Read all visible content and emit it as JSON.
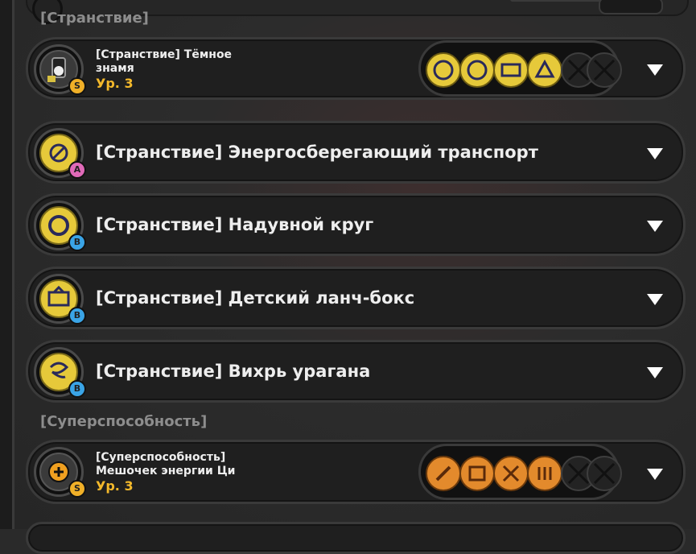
{
  "sections": {
    "wandering_label": "[Странствие]",
    "superpower_label": "[Суперспособность]"
  },
  "cards": [
    {
      "title_line1": "[Странствие] Тёмное",
      "title_line2": "знамя",
      "level": "Ур. 3",
      "badge": "S"
    },
    {
      "title": "[Странствие] Энергосберегающий транспорт",
      "badge": "A"
    },
    {
      "title": "[Странствие] Надувной круг",
      "badge": "B"
    },
    {
      "title": "[Странствие] Детский ланч-бокс",
      "badge": "B"
    },
    {
      "title": "[Странствие] Вихрь урагана",
      "badge": "B"
    },
    {
      "title_line1": "[Суперспособность]",
      "title_line2": "Мешочек энергии Ци",
      "level": "Ур. 3",
      "badge": "S"
    }
  ],
  "colors": {
    "accent_level": "#f4b92b",
    "rank_s": "#f0b028",
    "rank_a": "#e06ab8",
    "rank_b": "#3aa4e6"
  },
  "icons": {
    "expand": "chevron-down-icon",
    "empty_slot": "cross-icon"
  }
}
